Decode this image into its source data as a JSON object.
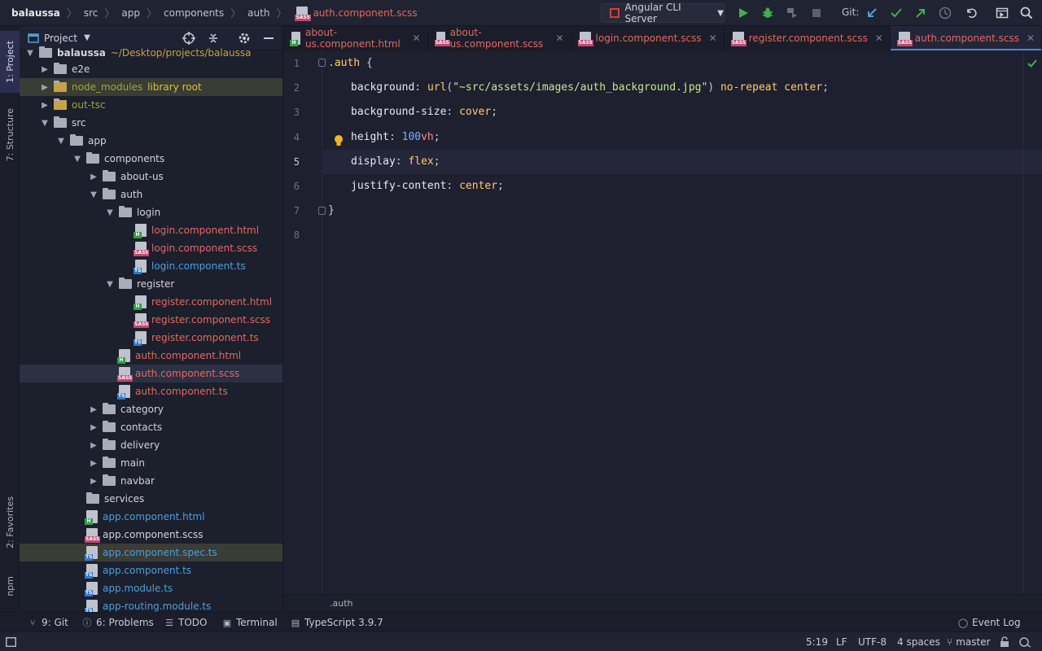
{
  "breadcrumb": [
    "balaussa",
    "src",
    "app",
    "components",
    "auth"
  ],
  "breadcrumb_file": "auth.component.scss",
  "run_config": "Angular CLI Server",
  "git_label": "Git:",
  "left_tabs": {
    "project": "1: Project",
    "structure": "7: Structure",
    "favorites": "2: Favorites",
    "npm": "npm"
  },
  "project_panel": {
    "title": "Project",
    "root_label": "balaussa",
    "root_path": "~/Desktop/projects/balaussa",
    "library_root": "library root",
    "items": [
      {
        "label": "e2e"
      },
      {
        "label": "node_modules"
      },
      {
        "label": "out-tsc"
      },
      {
        "label": "src"
      },
      {
        "label": "app"
      },
      {
        "label": "components"
      },
      {
        "label": "about-us"
      },
      {
        "label": "auth"
      },
      {
        "label": "login"
      },
      {
        "label": "login.component.html"
      },
      {
        "label": "login.component.scss"
      },
      {
        "label": "login.component.ts"
      },
      {
        "label": "register"
      },
      {
        "label": "register.component.html"
      },
      {
        "label": "register.component.scss"
      },
      {
        "label": "register.component.ts"
      },
      {
        "label": "auth.component.html"
      },
      {
        "label": "auth.component.scss"
      },
      {
        "label": "auth.component.ts"
      },
      {
        "label": "category"
      },
      {
        "label": "contacts"
      },
      {
        "label": "delivery"
      },
      {
        "label": "main"
      },
      {
        "label": "navbar"
      },
      {
        "label": "services"
      },
      {
        "label": "app.component.html"
      },
      {
        "label": "app.component.scss"
      },
      {
        "label": "app.component.spec.ts"
      },
      {
        "label": "app.component.ts"
      },
      {
        "label": "app.module.ts"
      },
      {
        "label": "app-routing.module.ts"
      }
    ]
  },
  "tabs": [
    {
      "label": "about-us.component.html"
    },
    {
      "label": "about-us.component.scss"
    },
    {
      "label": "login.component.scss"
    },
    {
      "label": "register.component.scss"
    },
    {
      "label": "auth.component.scss"
    }
  ],
  "editor": {
    "line_numbers": [
      "1",
      "2",
      "3",
      "4",
      "5",
      "6",
      "7",
      "8"
    ],
    "code": {
      "l1_sel": ".auth",
      "l1_brace": " {",
      "l2_prop": "background",
      "l2_fn": "url",
      "l2_str": "\"~src/assets/images/auth_background.jpg\"",
      "l2_kw": "no-repeat center",
      "l3_prop": "background-size",
      "l3_kw": "cover",
      "l4_prop": "height",
      "l4_num": "100",
      "l4_unit": "vh",
      "l5_prop": "display",
      "l5_kw": "flex",
      "l6_prop": "justify-content",
      "l6_kw": "center",
      "l7": "}"
    },
    "breadcrumb_status": ".auth"
  },
  "tool_windows": {
    "git": "9: Git",
    "problems": "6: Problems",
    "todo": "TODO",
    "terminal": "Terminal",
    "typescript": "TypeScript 3.9.7",
    "event_log": "Event Log"
  },
  "status": {
    "position": "5:19",
    "line_sep": "LF",
    "encoding": "UTF-8",
    "indent": "4 spaces",
    "branch": "master"
  },
  "colors": {
    "accent": "#4a86d8",
    "red_file": "#e26a5d",
    "blue_file": "#4d9fe0",
    "run_green": "#3fae4f"
  }
}
